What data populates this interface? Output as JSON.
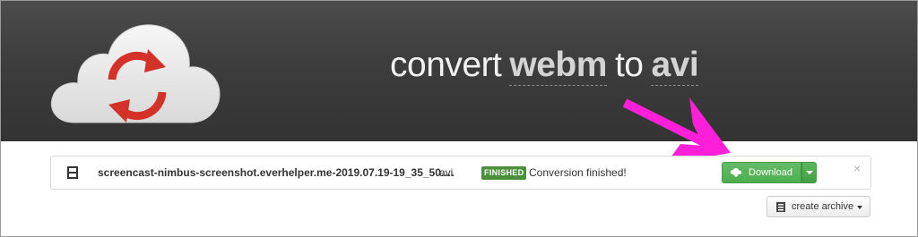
{
  "header": {
    "headline_prefix": "convert",
    "source_format": "webm",
    "connector": "to",
    "target_format": "avi",
    "background_color": "#3a3a3a",
    "logo_icon": "cloud-convert-logo"
  },
  "file": {
    "icon": "film-icon",
    "name": "screencast-nimbus-screenshot.everhelper.me-2019.07.19-19_35_50.…",
    "format": "avi",
    "status_badge": "FINISHED",
    "status_text": "Conversion finished!",
    "badge_color": "#4a8f3a"
  },
  "actions": {
    "download_label": "Download",
    "download_color": "#5cb85c",
    "close_symbol": "×",
    "archive_label": "create archive"
  },
  "annotation": {
    "arrow_color": "#ff1fd8"
  }
}
